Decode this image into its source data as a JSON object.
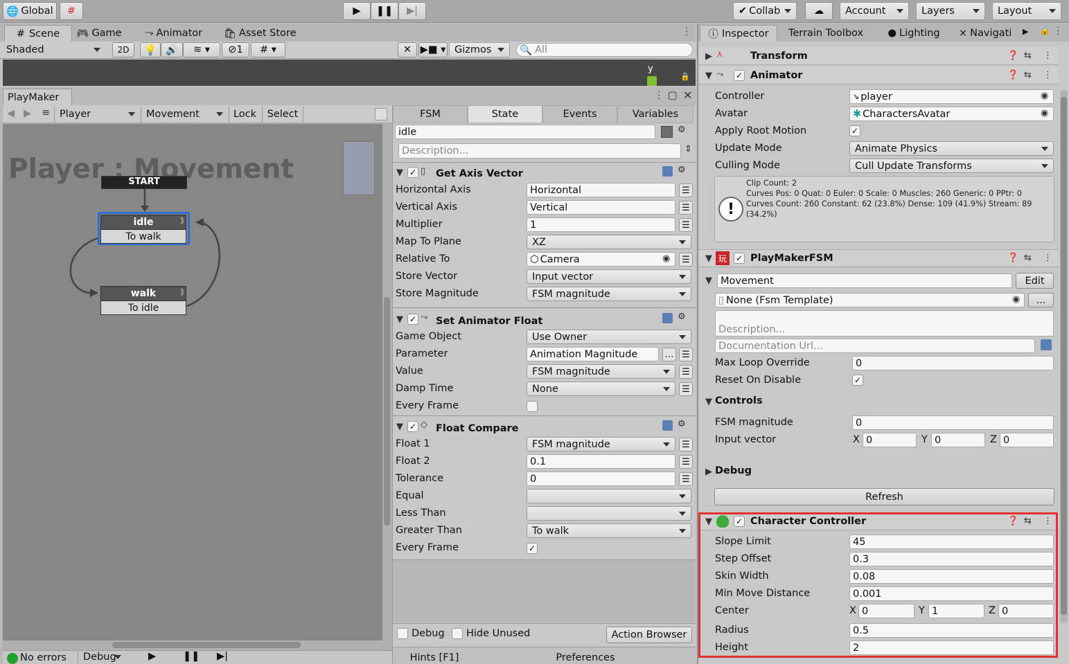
{
  "toolbar": {
    "global_label": "Global",
    "collab_label": "Collab",
    "account_label": "Account",
    "layers_label": "Layers",
    "layout_label": "Layout"
  },
  "scene_tabs": {
    "scene": "Scene",
    "game": "Game",
    "animator": "Animator",
    "asset_store": "Asset Store"
  },
  "scene_toolbar": {
    "shading": "Shaded",
    "mode_2d": "2D",
    "hidden_count": "1",
    "gizmos": "Gizmos",
    "search_placeholder": "All",
    "axis_label": "y"
  },
  "playmaker": {
    "title": "PlayMaker",
    "fsm_owner": "Player",
    "fsm_name": "Movement",
    "lock": "Lock",
    "select": "Select",
    "graph_title": "Player : Movement",
    "start": "START",
    "states": [
      {
        "name": "idle",
        "transition": "To walk"
      },
      {
        "name": "walk",
        "transition": "To idle"
      }
    ],
    "status": {
      "errors": "No errors",
      "debug": "Debug"
    }
  },
  "state_panel": {
    "tabs": [
      "FSM",
      "State",
      "Events",
      "Variables"
    ],
    "state_name": "idle",
    "description_placeholder": "Description...",
    "actions": [
      {
        "title": "Get Axis Vector",
        "rows": [
          [
            "Horizontal Axis",
            "Horizontal"
          ],
          [
            "Vertical Axis",
            "Vertical"
          ],
          [
            "Multiplier",
            "1"
          ],
          [
            "Map To Plane",
            "XZ"
          ],
          [
            "Relative To",
            "Camera"
          ],
          [
            "Store Vector",
            "Input vector"
          ],
          [
            "Store Magnitude",
            "FSM magnitude"
          ]
        ]
      },
      {
        "title": "Set Animator Float",
        "rows": [
          [
            "Game Object",
            "Use Owner"
          ],
          [
            "Parameter",
            "Animation Magnitude"
          ],
          [
            "Value",
            "FSM magnitude"
          ],
          [
            "Damp Time",
            "None"
          ],
          [
            "Every Frame",
            ""
          ]
        ]
      },
      {
        "title": "Float Compare",
        "rows": [
          [
            "Float 1",
            "FSM magnitude"
          ],
          [
            "Float 2",
            "0.1"
          ],
          [
            "Tolerance",
            "0"
          ],
          [
            "Equal",
            ""
          ],
          [
            "Less Than",
            ""
          ],
          [
            "Greater Than",
            "To walk"
          ],
          [
            "Every Frame",
            ""
          ]
        ]
      }
    ],
    "footer": {
      "debug": "Debug",
      "hide_unused": "Hide Unused",
      "action_browser": "Action Browser",
      "hints": "Hints [F1]",
      "preferences": "Preferences"
    }
  },
  "inspector": {
    "tabs": [
      "Inspector",
      "Terrain Toolbox",
      "Lighting",
      "Navigati"
    ],
    "transform": "Transform",
    "animator": {
      "title": "Animator",
      "rows": [
        [
          "Controller",
          "player"
        ],
        [
          "Avatar",
          "CharactersAvatar"
        ],
        [
          "Apply Root Motion",
          ""
        ],
        [
          "Update Mode",
          "Animate Physics"
        ],
        [
          "Culling Mode",
          "Cull Update Transforms"
        ]
      ],
      "info": "Clip Count: 2\nCurves Pos: 0 Quat: 0 Euler: 0 Scale: 0 Muscles: 260 Generic: 0 PPtr: 0\nCurves Count: 260 Constant: 62 (23.8%) Dense: 109 (41.9%) Stream: 89 (34.2%)"
    },
    "playmakerfsm": {
      "title": "PlayMakerFSM",
      "fsm": "Movement",
      "edit": "Edit",
      "template": "None (Fsm Template)",
      "more": "...",
      "description_placeholder": "Description...",
      "doc_placeholder": "Documentation Url...",
      "max_loop_label": "Max Loop Override",
      "max_loop_value": "0",
      "reset_label": "Reset On Disable",
      "controls": "Controls",
      "fsm_magnitude_label": "FSM magnitude",
      "fsm_magnitude_value": "0",
      "input_vector_label": "Input vector",
      "input_x": "0",
      "input_y": "0",
      "input_z": "0",
      "debug": "Debug",
      "refresh": "Refresh"
    },
    "character_controller": {
      "title": "Character Controller",
      "rows": [
        [
          "Slope Limit",
          "45"
        ],
        [
          "Step Offset",
          "0.3"
        ],
        [
          "Skin Width",
          "0.08"
        ],
        [
          "Min Move Distance",
          "0.001"
        ]
      ],
      "center_label": "Center",
      "center_x": "0",
      "center_y": "1",
      "center_z": "0",
      "radius_label": "Radius",
      "radius": "0.5",
      "height_label": "Height",
      "height": "2"
    }
  },
  "colors": {
    "highlight": "#e03030",
    "selected_node": "#2a6fd6",
    "panel_bg": "#c8c8c8"
  }
}
